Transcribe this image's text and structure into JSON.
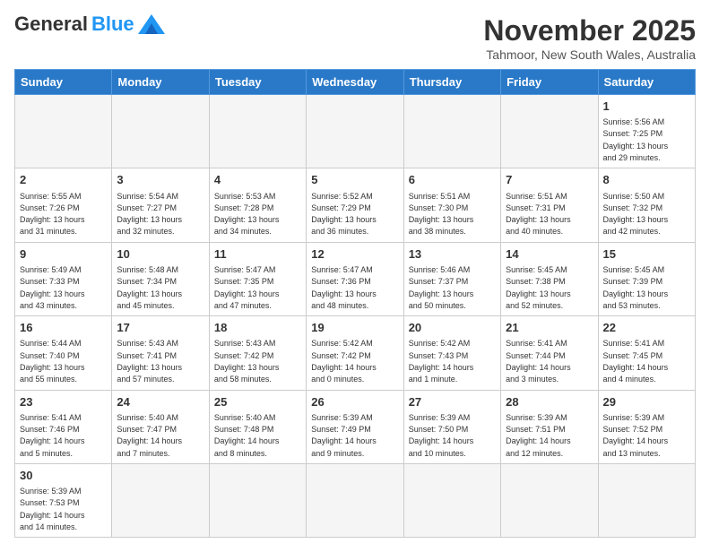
{
  "header": {
    "logo_general": "General",
    "logo_blue": "Blue",
    "month_title": "November 2025",
    "subtitle": "Tahmoor, New South Wales, Australia"
  },
  "weekdays": [
    "Sunday",
    "Monday",
    "Tuesday",
    "Wednesday",
    "Thursday",
    "Friday",
    "Saturday"
  ],
  "weeks": [
    [
      {
        "day": "",
        "info": ""
      },
      {
        "day": "",
        "info": ""
      },
      {
        "day": "",
        "info": ""
      },
      {
        "day": "",
        "info": ""
      },
      {
        "day": "",
        "info": ""
      },
      {
        "day": "",
        "info": ""
      },
      {
        "day": "1",
        "info": "Sunrise: 5:56 AM\nSunset: 7:25 PM\nDaylight: 13 hours\nand 29 minutes."
      }
    ],
    [
      {
        "day": "2",
        "info": "Sunrise: 5:55 AM\nSunset: 7:26 PM\nDaylight: 13 hours\nand 31 minutes."
      },
      {
        "day": "3",
        "info": "Sunrise: 5:54 AM\nSunset: 7:27 PM\nDaylight: 13 hours\nand 32 minutes."
      },
      {
        "day": "4",
        "info": "Sunrise: 5:53 AM\nSunset: 7:28 PM\nDaylight: 13 hours\nand 34 minutes."
      },
      {
        "day": "5",
        "info": "Sunrise: 5:52 AM\nSunset: 7:29 PM\nDaylight: 13 hours\nand 36 minutes."
      },
      {
        "day": "6",
        "info": "Sunrise: 5:51 AM\nSunset: 7:30 PM\nDaylight: 13 hours\nand 38 minutes."
      },
      {
        "day": "7",
        "info": "Sunrise: 5:51 AM\nSunset: 7:31 PM\nDaylight: 13 hours\nand 40 minutes."
      },
      {
        "day": "8",
        "info": "Sunrise: 5:50 AM\nSunset: 7:32 PM\nDaylight: 13 hours\nand 42 minutes."
      }
    ],
    [
      {
        "day": "9",
        "info": "Sunrise: 5:49 AM\nSunset: 7:33 PM\nDaylight: 13 hours\nand 43 minutes."
      },
      {
        "day": "10",
        "info": "Sunrise: 5:48 AM\nSunset: 7:34 PM\nDaylight: 13 hours\nand 45 minutes."
      },
      {
        "day": "11",
        "info": "Sunrise: 5:47 AM\nSunset: 7:35 PM\nDaylight: 13 hours\nand 47 minutes."
      },
      {
        "day": "12",
        "info": "Sunrise: 5:47 AM\nSunset: 7:36 PM\nDaylight: 13 hours\nand 48 minutes."
      },
      {
        "day": "13",
        "info": "Sunrise: 5:46 AM\nSunset: 7:37 PM\nDaylight: 13 hours\nand 50 minutes."
      },
      {
        "day": "14",
        "info": "Sunrise: 5:45 AM\nSunset: 7:38 PM\nDaylight: 13 hours\nand 52 minutes."
      },
      {
        "day": "15",
        "info": "Sunrise: 5:45 AM\nSunset: 7:39 PM\nDaylight: 13 hours\nand 53 minutes."
      }
    ],
    [
      {
        "day": "16",
        "info": "Sunrise: 5:44 AM\nSunset: 7:40 PM\nDaylight: 13 hours\nand 55 minutes."
      },
      {
        "day": "17",
        "info": "Sunrise: 5:43 AM\nSunset: 7:41 PM\nDaylight: 13 hours\nand 57 minutes."
      },
      {
        "day": "18",
        "info": "Sunrise: 5:43 AM\nSunset: 7:42 PM\nDaylight: 13 hours\nand 58 minutes."
      },
      {
        "day": "19",
        "info": "Sunrise: 5:42 AM\nSunset: 7:42 PM\nDaylight: 14 hours\nand 0 minutes."
      },
      {
        "day": "20",
        "info": "Sunrise: 5:42 AM\nSunset: 7:43 PM\nDaylight: 14 hours\nand 1 minute."
      },
      {
        "day": "21",
        "info": "Sunrise: 5:41 AM\nSunset: 7:44 PM\nDaylight: 14 hours\nand 3 minutes."
      },
      {
        "day": "22",
        "info": "Sunrise: 5:41 AM\nSunset: 7:45 PM\nDaylight: 14 hours\nand 4 minutes."
      }
    ],
    [
      {
        "day": "23",
        "info": "Sunrise: 5:41 AM\nSunset: 7:46 PM\nDaylight: 14 hours\nand 5 minutes."
      },
      {
        "day": "24",
        "info": "Sunrise: 5:40 AM\nSunset: 7:47 PM\nDaylight: 14 hours\nand 7 minutes."
      },
      {
        "day": "25",
        "info": "Sunrise: 5:40 AM\nSunset: 7:48 PM\nDaylight: 14 hours\nand 8 minutes."
      },
      {
        "day": "26",
        "info": "Sunrise: 5:39 AM\nSunset: 7:49 PM\nDaylight: 14 hours\nand 9 minutes."
      },
      {
        "day": "27",
        "info": "Sunrise: 5:39 AM\nSunset: 7:50 PM\nDaylight: 14 hours\nand 10 minutes."
      },
      {
        "day": "28",
        "info": "Sunrise: 5:39 AM\nSunset: 7:51 PM\nDaylight: 14 hours\nand 12 minutes."
      },
      {
        "day": "29",
        "info": "Sunrise: 5:39 AM\nSunset: 7:52 PM\nDaylight: 14 hours\nand 13 minutes."
      }
    ],
    [
      {
        "day": "30",
        "info": "Sunrise: 5:39 AM\nSunset: 7:53 PM\nDaylight: 14 hours\nand 14 minutes."
      },
      {
        "day": "",
        "info": ""
      },
      {
        "day": "",
        "info": ""
      },
      {
        "day": "",
        "info": ""
      },
      {
        "day": "",
        "info": ""
      },
      {
        "day": "",
        "info": ""
      },
      {
        "day": "",
        "info": ""
      }
    ]
  ]
}
